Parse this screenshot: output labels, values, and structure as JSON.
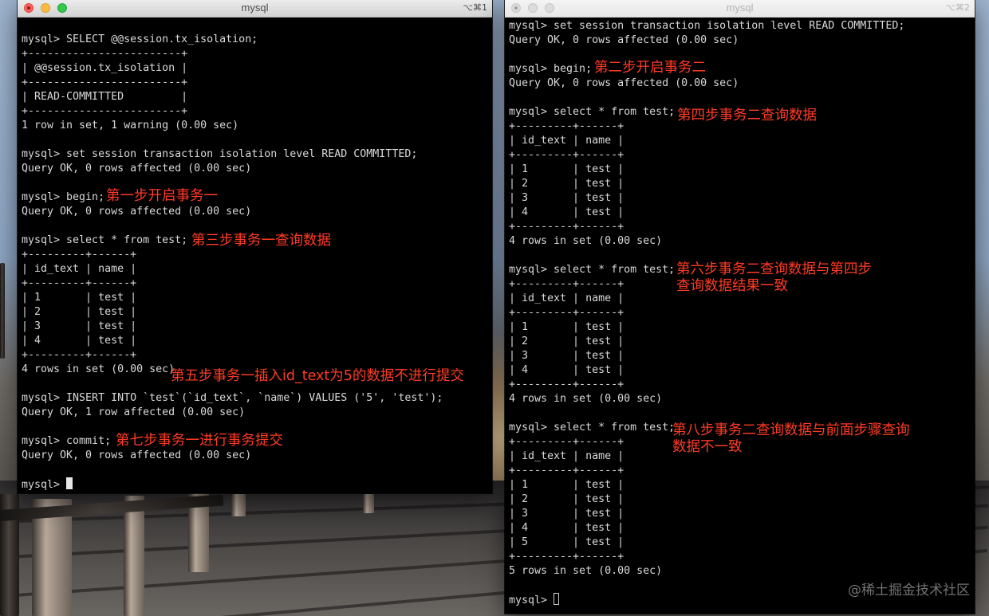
{
  "left_window": {
    "title": "mysql",
    "shortcut": "⌥⌘1",
    "lines": [
      "",
      "mysql> SELECT @@session.tx_isolation;",
      "+------------------------+",
      "| @@session.tx_isolation |",
      "+------------------------+",
      "| READ-COMMITTED         |",
      "+------------------------+",
      "1 row in set, 1 warning (0.00 sec)",
      "",
      "mysql> set session transaction isolation level READ COMMITTED;",
      "Query OK, 0 rows affected (0.00 sec)",
      "",
      "mysql> begin;",
      "Query OK, 0 rows affected (0.00 sec)",
      "",
      "mysql> select * from test;",
      "+---------+------+",
      "| id_text | name |",
      "+---------+------+",
      "| 1       | test |",
      "| 2       | test |",
      "| 3       | test |",
      "| 4       | test |",
      "+---------+------+",
      "4 rows in set (0.00 sec)",
      "",
      "mysql> INSERT INTO `test`(`id_text`, `name`) VALUES ('5', 'test');",
      "Query OK, 1 row affected (0.00 sec)",
      "",
      "mysql> commit;",
      "Query OK, 0 rows affected (0.00 sec)",
      "",
      "mysql> "
    ],
    "notes": [
      "第一步开启事务一",
      "第三步事务一查询数据",
      "第五步事务一插入id_text为5的数据不进行提交",
      "第七步事务一进行事务提交"
    ]
  },
  "right_window": {
    "title": "mysql",
    "shortcut": "⌥⌘2",
    "lines": [
      "mysql> set session transaction isolation level READ COMMITTED;",
      "Query OK, 0 rows affected (0.00 sec)",
      "",
      "mysql> begin;",
      "Query OK, 0 rows affected (0.00 sec)",
      "",
      "mysql> select * from test;",
      "+---------+------+",
      "| id_text | name |",
      "+---------+------+",
      "| 1       | test |",
      "| 2       | test |",
      "| 3       | test |",
      "| 4       | test |",
      "+---------+------+",
      "4 rows in set (0.00 sec)",
      "",
      "mysql> select * from test;",
      "+---------+------+",
      "| id_text | name |",
      "+---------+------+",
      "| 1       | test |",
      "| 2       | test |",
      "| 3       | test |",
      "| 4       | test |",
      "+---------+------+",
      "4 rows in set (0.00 sec)",
      "",
      "mysql> select * from test;",
      "+---------+------+",
      "| id_text | name |",
      "+---------+------+",
      "| 1       | test |",
      "| 2       | test |",
      "| 3       | test |",
      "| 4       | test |",
      "| 5       | test |",
      "+---------+------+",
      "5 rows in set (0.00 sec)",
      "",
      "mysql> "
    ],
    "notes": [
      "第二步开启事务二",
      "第四步事务二查询数据",
      "第六步事务二查询数据与第四步\n查询数据结果一致",
      "第八步事务二查询数据与前面步骤查询\n数据不一致"
    ]
  },
  "watermark": "@稀土掘金技术社区",
  "colors": {
    "terminal_bg": "#000000",
    "terminal_text": "#d9d9d9",
    "annotation": "#ff3b25",
    "close_button": "#fc605b",
    "minimize_button": "#fdbc40",
    "zoom_button": "#34c84a"
  }
}
